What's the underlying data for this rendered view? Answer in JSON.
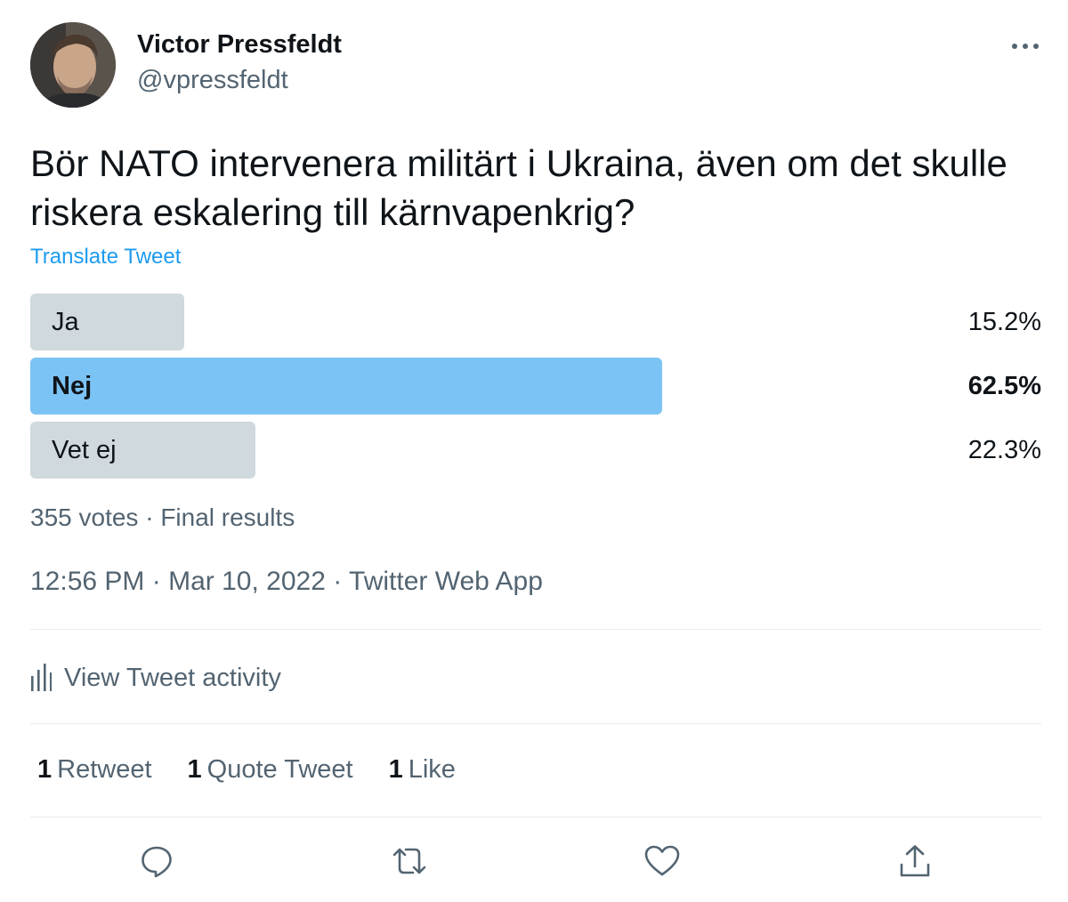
{
  "author": {
    "name": "Victor Pressfeldt",
    "handle": "@vpressfeldt"
  },
  "tweet": {
    "text": "Bör NATO intervenera militärt i Ukraina, även om det skulle riskera eskalering till kärnvapenkrig?",
    "translate_label": "Translate Tweet"
  },
  "poll": {
    "options": [
      {
        "label": "Ja",
        "percent_label": "15.2%",
        "percent": 15.2,
        "winner": false
      },
      {
        "label": "Nej",
        "percent_label": "62.5%",
        "percent": 62.5,
        "winner": true
      },
      {
        "label": "Vet ej",
        "percent_label": "22.3%",
        "percent": 22.3,
        "winner": false
      }
    ],
    "votes_label": "355 votes",
    "status_label": "Final results",
    "separator": "·",
    "winner_color": "#7cc3f5",
    "other_color": "#cfd9de"
  },
  "meta": {
    "time": "12:56 PM",
    "date": "Mar 10, 2022",
    "source": "Twitter Web App",
    "separator": "·"
  },
  "activity": {
    "label": "View Tweet activity",
    "icon": "analytics-icon"
  },
  "stats": [
    {
      "count": "1",
      "label": "Retweet"
    },
    {
      "count": "1",
      "label": "Quote Tweet"
    },
    {
      "count": "1",
      "label": "Like"
    }
  ],
  "actions": [
    {
      "name": "reply",
      "icon": "reply-icon"
    },
    {
      "name": "retweet",
      "icon": "retweet-icon"
    },
    {
      "name": "like",
      "icon": "heart-icon"
    },
    {
      "name": "share",
      "icon": "share-icon"
    }
  ],
  "colors": {
    "link": "#1d9bf0",
    "secondary_text": "#536471",
    "primary_text": "#0f1419",
    "divider": "#e6ecf0"
  }
}
